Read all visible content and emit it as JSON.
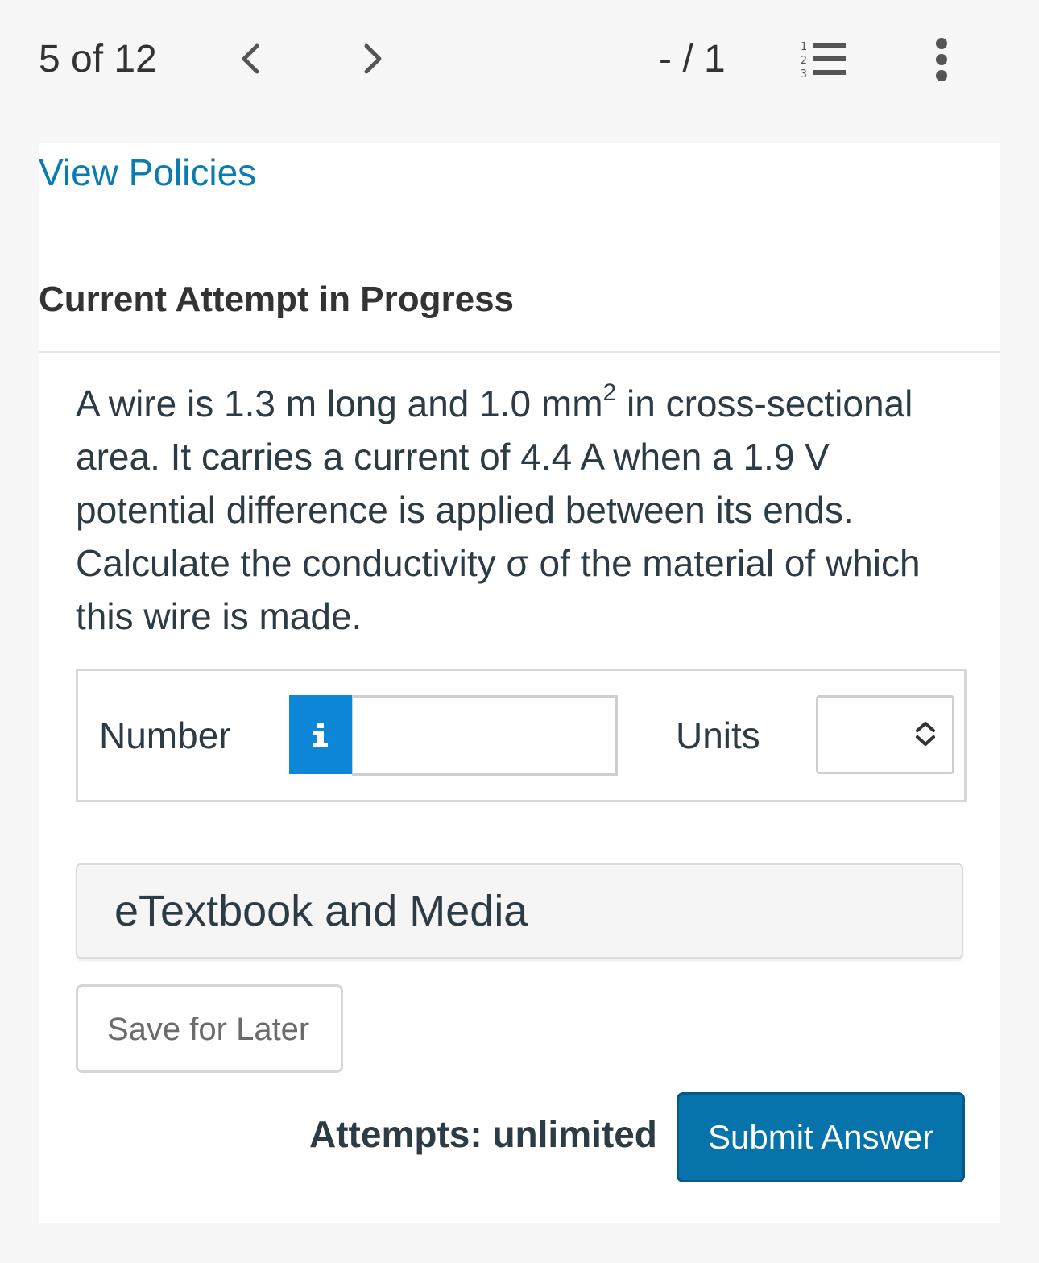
{
  "header": {
    "counter": "5 of 12",
    "prev_icon": "chevron-left-icon",
    "next_icon": "chevron-right-icon",
    "score": "- / 1",
    "list_icon": "numbered-list-icon",
    "more_icon": "more-vertical-icon"
  },
  "card": {
    "policies_link": "View Policies",
    "section_title": "Current Attempt in Progress",
    "question": {
      "before_sup": "A wire is 1.3 m long and 1.0 mm",
      "sup": "2",
      "after_sup": " in cross-sectional area. It carries a current of 4.4 A when a 1.9 V potential difference is applied between its ends. Calculate the conductivity σ of the material of which this wire is made."
    },
    "answer": {
      "number_label": "Number",
      "info_icon_glyph": "i",
      "number_value": "",
      "units_label": "Units",
      "units_value": "",
      "units_icon": "up-down-chevron-icon"
    },
    "etextbook_label": "eTextbook and Media",
    "save_label": "Save for Later",
    "attempts_label": "Attempts: unlimited",
    "submit_label": "Submit Answer"
  },
  "colors": {
    "link": "#0a7bb3",
    "info_button": "#0f87d9",
    "submit_button": "#0673aa",
    "background": "#f7f7f7"
  }
}
